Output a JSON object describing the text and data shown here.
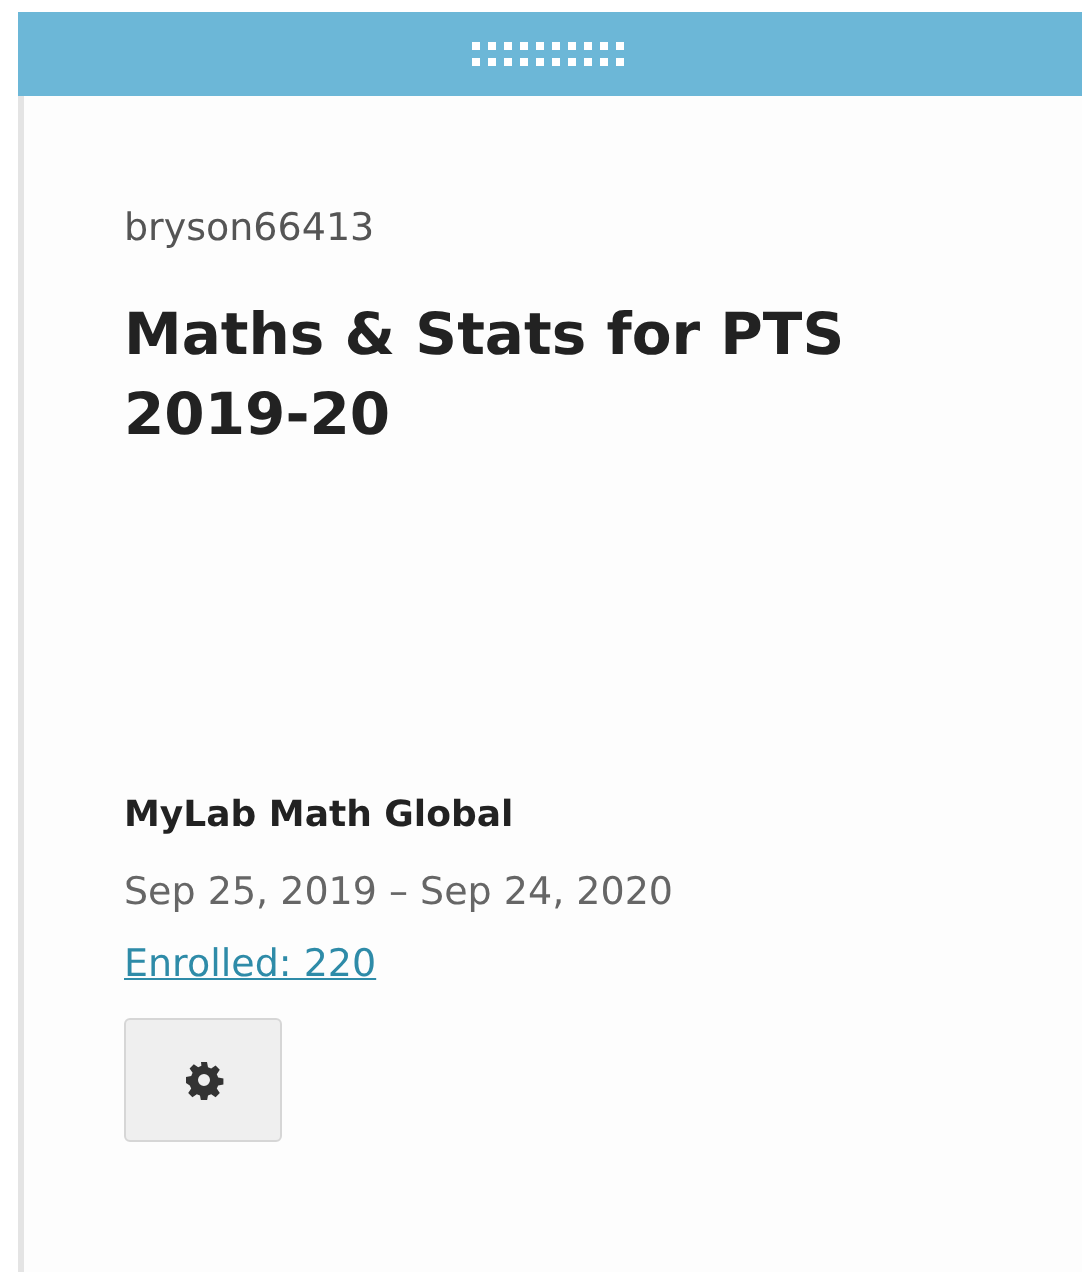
{
  "owner": "bryson66413",
  "course_title": "Maths & Stats for PTS 2019-20",
  "product": "MyLab Math Global",
  "dates": "Sep 25, 2019 – Sep 24, 2020",
  "enrolled_link": "Enrolled: 220"
}
